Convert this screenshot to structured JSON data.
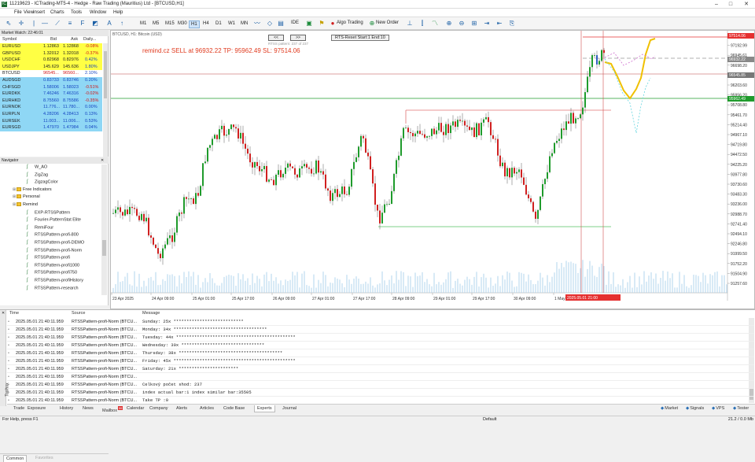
{
  "window": {
    "title": "11219623 - ICTrading-MT5-4 - Hedge - Raw Trading (Mauritius) Ltd - [BTCUSD,H1]",
    "app_icon": "IC"
  },
  "menu": [
    "File",
    "View",
    "Insert",
    "Charts",
    "Tools",
    "Window",
    "Help"
  ],
  "toolbar": {
    "timeframes": [
      "M1",
      "M5",
      "M15",
      "M30",
      "H1",
      "H4",
      "D1",
      "W1",
      "MN"
    ],
    "active_timeframe": "H1",
    "algo_trading": "Algo Trading",
    "new_order": "New Order",
    "ide": "IDE"
  },
  "market_watch": {
    "header": "Market Watch: 22:46:01",
    "columns": [
      "Symbol",
      "Bid",
      "Ask",
      "Daily..."
    ],
    "rows": [
      {
        "symbol": "EURUSD",
        "bid": "1.12863",
        "ask": "1.12868",
        "change": "-0.08%",
        "bg": "y"
      },
      {
        "symbol": "GBPUSD",
        "bid": "1.32012",
        "ask": "1.32018",
        "change": "-0.37%",
        "bg": "y"
      },
      {
        "symbol": "USDCHF",
        "bid": "0.82968",
        "ask": "0.82976",
        "change": "0.42%",
        "bg": "y"
      },
      {
        "symbol": "USDJPY",
        "bid": "145.629",
        "ask": "145.636",
        "change": "1.80%",
        "bg": "y"
      },
      {
        "symbol": "BTCUSD",
        "bid": "96545...",
        "ask": "96560...",
        "change": "2.10%",
        "bg": "w"
      },
      {
        "symbol": "AUDSGD",
        "bid": "0.83733",
        "ask": "0.83746",
        "change": "0.20%",
        "bg": "b"
      },
      {
        "symbol": "CHFSGD",
        "bid": "1.58006",
        "ask": "1.58023",
        "change": "-0.51%",
        "bg": "b"
      },
      {
        "symbol": "EURDKK",
        "bid": "7.46246",
        "ask": "7.46316",
        "change": "-0.02%",
        "bg": "b"
      },
      {
        "symbol": "EURHKD",
        "bid": "8.75560",
        "ask": "8.75586",
        "change": "-0.35%",
        "bg": "b"
      },
      {
        "symbol": "EURNOK",
        "bid": "11.776...",
        "ask": "11.780...",
        "change": "0.00%",
        "bg": "b"
      },
      {
        "symbol": "EURPLN",
        "bid": "4.28206",
        "ask": "4.28413",
        "change": "0.13%",
        "bg": "b"
      },
      {
        "symbol": "EURSEK",
        "bid": "11.003...",
        "ask": "11.006...",
        "change": "0.53%",
        "bg": "b"
      },
      {
        "symbol": "EURSGD",
        "bid": "1.47970",
        "ask": "1.47984",
        "change": "0.04%",
        "bg": "b"
      }
    ],
    "tabs": [
      "Symbols",
      "Details",
      "Trading",
      "Ticks"
    ]
  },
  "navigator": {
    "header": "Navigator",
    "items": [
      {
        "label": "W_AO",
        "type": "ind",
        "indent": 2
      },
      {
        "label": "ZigZag",
        "type": "ind",
        "indent": 2
      },
      {
        "label": "ZigzagColor",
        "type": "ind",
        "indent": 2
      },
      {
        "label": "Free Indicators",
        "type": "fold",
        "indent": 1
      },
      {
        "label": "Personal",
        "type": "fold",
        "indent": 1
      },
      {
        "label": "Remind",
        "type": "fold",
        "indent": 1
      },
      {
        "label": "EXP-RTSSPattern",
        "type": "ind",
        "indent": 2
      },
      {
        "label": "Fourier-PatternStat Elite",
        "type": "ind",
        "indent": 2
      },
      {
        "label": "RemiFour",
        "type": "ind",
        "indent": 2
      },
      {
        "label": "RTSSPattern-profi-800",
        "type": "ind",
        "indent": 2
      },
      {
        "label": "RTSSPattern-profi-DEMO",
        "type": "ind",
        "indent": 2
      },
      {
        "label": "RTSSPattern-profi-Norm",
        "type": "ind",
        "indent": 2
      },
      {
        "label": "RTSSPattern-profi",
        "type": "ind",
        "indent": 2
      },
      {
        "label": "RTSSPattern-profi1000",
        "type": "ind",
        "indent": 2
      },
      {
        "label": "RTSSPattern-profi750",
        "type": "ind",
        "indent": 2
      },
      {
        "label": "RTSSPattern-profiHistory",
        "type": "ind",
        "indent": 2
      },
      {
        "label": "RTSSPattern-research",
        "type": "ind",
        "indent": 2
      }
    ],
    "tabs": [
      "Common",
      "Favorites"
    ]
  },
  "chart": {
    "symbol_label": "BTCUSD, H1:  Bitcoin (USD)",
    "rts_label": "RTS-Reset Start:1 End:10",
    "remind_text": "remind.cz SELL at 96932.22   TP: 95962.49   SL: 97514.06",
    "nav_prev": "<<",
    "nav_next": ">>",
    "small_text": "RTSS pattern: 237 of 237",
    "price_ticks": [
      "97440.37",
      "97192.99",
      "96945.61",
      "96698.20",
      "96450.90",
      "96203.60",
      "95956.20",
      "95708.80",
      "95461.70",
      "95214.40",
      "94967.10",
      "94719.80",
      "94472.50",
      "94225.20",
      "93977.80",
      "93730.60",
      "93483.30",
      "93236.00",
      "92988.70",
      "92741.40",
      "92494.10",
      "92246.80",
      "91999.50",
      "91752.20",
      "91504.90",
      "91257.60"
    ],
    "price_tags": [
      {
        "value": "97514.06",
        "color": "#e53030"
      },
      {
        "value": "96932.22",
        "color": "#888888"
      },
      {
        "value": "96545.85",
        "color": "#777777"
      },
      {
        "value": "95962.49",
        "color": "#1f9b2c"
      }
    ],
    "time_ticks": [
      "23 Apr 2025",
      "24 Apr 09:00",
      "25 Apr 01:00",
      "25 Apr 17:00",
      "26 Apr 09:00",
      "27 Apr 01:00",
      "27 Apr 17:00",
      "28 Apr 09:00",
      "29 Apr 01:00",
      "29 Apr 17:00",
      "30 Apr 09:00",
      "1 May"
    ],
    "time_highlight": "2025.05.01 21:00"
  },
  "journal": {
    "columns": [
      "Time",
      "Source",
      "Message"
    ],
    "rows": [
      {
        "time": "2025.05.01 21:40:11.959",
        "source": "RTSSPattern-profi-Norm (BTCU...",
        "msg": "Sunday: 25x ***************************"
      },
      {
        "time": "2025.05.01 21:40:11.959",
        "source": "RTSSPattern-profi-Norm (BTCU...",
        "msg": "Monday: 34x ************************************"
      },
      {
        "time": "2025.05.01 21:40:11.959",
        "source": "RTSSPattern-profi-Norm (BTCU...",
        "msg": "Tuesday: 44x **********************************************"
      },
      {
        "time": "2025.05.01 21:40:11.959",
        "source": "RTSSPattern-profi-Norm (BTCU...",
        "msg": "Wednesday: 30x ********************************"
      },
      {
        "time": "2025.05.01 21:40:11.959",
        "source": "RTSSPattern-profi-Norm (BTCU...",
        "msg": "Thursday: 38x ****************************************"
      },
      {
        "time": "2025.05.01 21:40:11.959",
        "source": "RTSSPattern-profi-Norm (BTCU...",
        "msg": "Friday: 45x ***********************************************"
      },
      {
        "time": "2025.05.01 21:40:11.959",
        "source": "RTSSPattern-profi-Norm (BTCU...",
        "msg": "Saturday: 21x ***********************"
      },
      {
        "time": "2025.05.01 21:40:11.959",
        "source": "RTSSPattern-profi-Norm (BTCU...",
        "msg": ""
      },
      {
        "time": "2025.05.01 21:40:11.959",
        "source": "RTSSPattern-profi-Norm (BTCU...",
        "msg": "Celkový počet shod: 237"
      },
      {
        "time": "2025.05.01 21:40:11.959",
        "source": "RTSSPattern-profi-Norm (BTCU...",
        "msg": " index actual bar:1 index similar bar:35505"
      },
      {
        "time": "2025.05.01 21:40:11.959",
        "source": "RTSSPattern-profi-Norm (BTCU...",
        "msg": "Take TP :0"
      }
    ]
  },
  "bottom_tabs": [
    "Trade",
    "Exposure",
    "History",
    "News",
    "Mailbox",
    "Calendar",
    "Company",
    "Alerts",
    "Articles",
    "Code Base",
    "Experts",
    "Journal"
  ],
  "mailbox_badge": "59",
  "active_bottom_tab": "Experts",
  "bottom_right": [
    "Market",
    "Signals",
    "VPS",
    "Tester"
  ],
  "toolbox_label": "Toolbox",
  "status": {
    "help": "For Help, press F1",
    "profile": "Default",
    "traffic": "21.2 / 0.0 Mb"
  }
}
